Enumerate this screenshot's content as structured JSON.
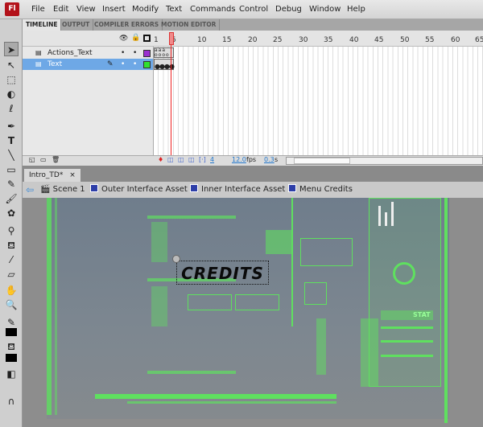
{
  "app": {
    "logo": "Fl"
  },
  "menu": [
    "File",
    "Edit",
    "View",
    "Insert",
    "Modify",
    "Text",
    "Commands",
    "Control",
    "Debug",
    "Window",
    "Help"
  ],
  "panel_tabs": [
    "TIMELINE",
    "OUTPUT",
    "COMPILER ERRORS",
    "MOTION EDITOR"
  ],
  "timeline": {
    "frame_numbers": [
      "1",
      "5",
      "10",
      "15",
      "20",
      "25",
      "30",
      "35",
      "40",
      "45",
      "50",
      "55",
      "60",
      "65"
    ],
    "layers": [
      {
        "name": "Actions_Text",
        "color": "#9a30d0",
        "selected": false
      },
      {
        "name": "Text",
        "color": "#30e030",
        "selected": true
      }
    ],
    "current_frame": "4",
    "fps": "12.0",
    "fps_unit": "fps",
    "time": "0.3",
    "time_unit": "s"
  },
  "document": {
    "tab": "Intro_TD*",
    "close": "×"
  },
  "breadcrumb": [
    "Scene 1",
    "Outer Interface Asset",
    "Inner Interface Asset",
    "Menu Credits"
  ],
  "stage": {
    "credits_text": "CREDITS",
    "stat_label": "STAT"
  }
}
